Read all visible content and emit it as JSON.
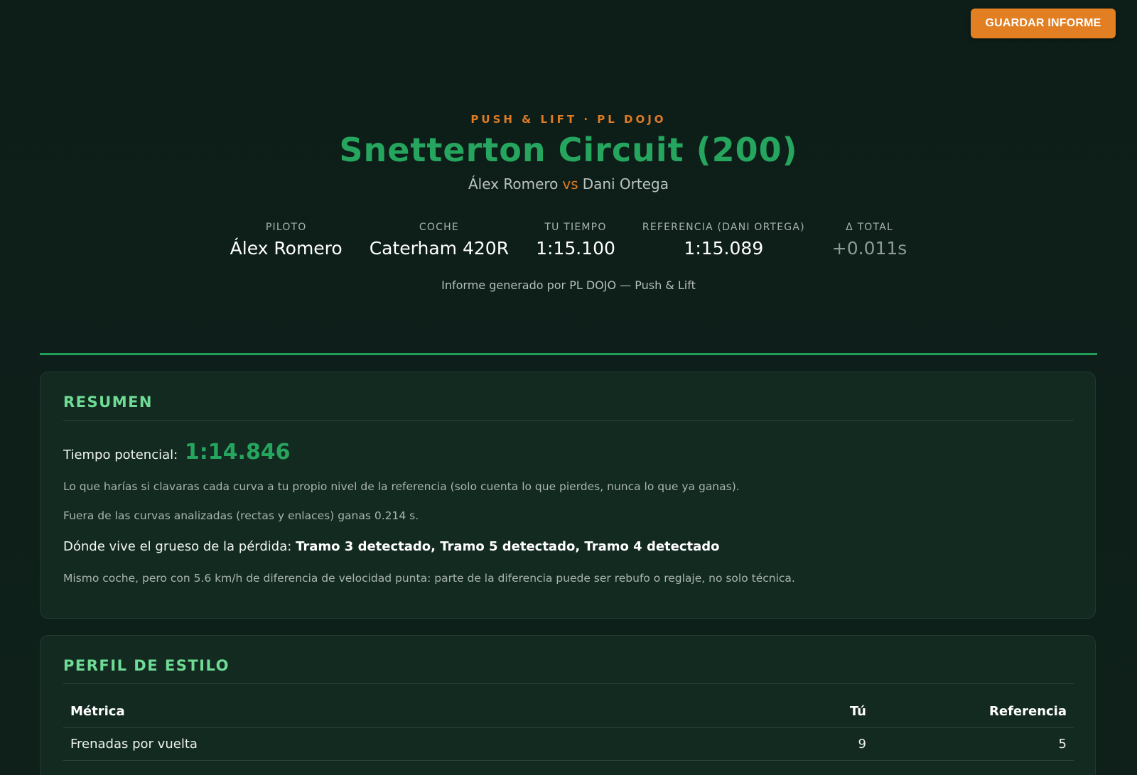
{
  "toolbar": {
    "save_label": "GUARDAR INFORME"
  },
  "header": {
    "eyebrow": "PUSH & LIFT · PL DOJO",
    "title": "Snetterton Circuit (200)",
    "driver": "Álex Romero",
    "vs": "vs",
    "reference_driver": "Dani Ortega"
  },
  "stats": [
    {
      "label": "PILOTO",
      "value": "Álex Romero"
    },
    {
      "label": "COCHE",
      "value": "Caterham 420R"
    },
    {
      "label": "TU TIEMPO",
      "value": "1:15.100"
    },
    {
      "label": "REFERENCIA (DANI ORTEGA)",
      "value": "1:15.089"
    },
    {
      "label": "Δ TOTAL",
      "value": "+0.011s"
    }
  ],
  "generated_note": "Informe generado por PL DOJO — Push & Lift",
  "resumen": {
    "title": "RESUMEN",
    "potential_label": "Tiempo potencial:",
    "potential_value": "1:14.846",
    "p1": "Lo que harías si clavaras cada curva a tu propio nivel de la referencia (solo cuenta lo que pierdes, nunca lo que ya ganas).",
    "p2": "Fuera de las curvas analizadas (rectas y enlaces) ganas 0.214 s.",
    "loss_label": "Dónde vive el grueso de la pérdida:",
    "loss_value": "Tramo 3 detectado, Tramo 5 detectado, Tramo 4 detectado",
    "p4": "Mismo coche, pero con 5.6 km/h de diferencia de velocidad punta: parte de la diferencia puede ser rebufo o reglaje, no solo técnica."
  },
  "perfil": {
    "title": "PERFIL DE ESTILO",
    "columns": [
      "Métrica",
      "Tú",
      "Referencia"
    ],
    "rows": [
      {
        "metric": "Frenadas por vuelta",
        "tu": "9",
        "ref": "5"
      }
    ]
  },
  "colors": {
    "accent_orange": "#e17f22",
    "accent_green": "#25a55e",
    "heading_green": "#6fdc95",
    "background": "#0d1d18",
    "card": "#132a21"
  }
}
